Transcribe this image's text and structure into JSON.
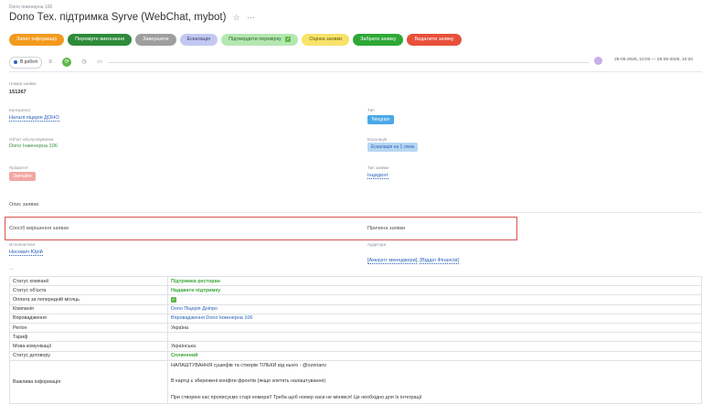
{
  "breadcrumb": "Dono Інженерна 106",
  "title": "Dono Тех. підтримка Syrve (WebChat, mybot)",
  "actions": [
    {
      "label": "Запит інформації",
      "color": "#f39a1e"
    },
    {
      "label": "Перевірте виконання",
      "color": "#2e8b3a"
    },
    {
      "label": "Завершити",
      "color": "#9e9e9e"
    },
    {
      "label": "Ескалація",
      "color": "#c3c8f2"
    },
    {
      "label": "Підтвердити перевірку",
      "color": "#b5e7b1"
    },
    {
      "label": "Оцінка заявки",
      "color": "#f7e36a"
    },
    {
      "label": "Забрати заявку",
      "color": "#2ea836"
    },
    {
      "label": "Видалити заявку",
      "color": "#e8503a"
    }
  ],
  "status": {
    "label": "В роботі",
    "date_range": "28-05-2026, 10:03 — 28-05-2026, 10:20"
  },
  "fields": {
    "number_label": "Номер заявки",
    "number_value": "151267",
    "contractor_label": "Контрагент",
    "contractor_value": "Наталі піцерія ДОНО",
    "type_label": "Тип",
    "type_value": "Telegram",
    "object_label": "Об'єкт обслуговування",
    "object_value": "Dono Інженерна 106",
    "escalation_label": "Ескалація",
    "escalation_value": "Ескалація на 1 лінію",
    "priority_label": "Пріоритет",
    "priority_value": "Звичайні",
    "request_type_label": "Тип заявки",
    "request_type_value": "Інцидент",
    "description_label": "Опис заявки",
    "solution_label": "Спосіб вирішення заявки",
    "cause_label": "Причина заявки",
    "executor_label": "Исполнители",
    "executor_value": "Носевич Юрій",
    "auditors_label": "Аудитори",
    "auditor_1": "[Аккаунт менеджери]",
    "auditor_2": "[Відділ Фінансів]",
    "ellipsis": "..."
  },
  "props": [
    {
      "key": "Статус компанії",
      "value": "Підтримка ресторан",
      "style": "g"
    },
    {
      "key": "Статус об'єкта",
      "value": "Надавати підтримку",
      "style": "g"
    },
    {
      "key": "Оплата за попередній місяць",
      "value": "",
      "style": "chk"
    },
    {
      "key": "Компанія",
      "value": "Dono Піцерія Дніпро",
      "style": "b"
    },
    {
      "key": "Впровадження",
      "value": "Впровадження Dono Інженерна 106",
      "style": "b"
    },
    {
      "key": "Регіон",
      "value": "Україна",
      "style": ""
    },
    {
      "key": "Тариф",
      "value": "",
      "style": ""
    },
    {
      "key": "Мова комунікації",
      "value": "Українська",
      "style": ""
    },
    {
      "key": "Статус договору",
      "value": "Сплачений",
      "style": "g"
    }
  ],
  "important": {
    "key": "Важлива інформація",
    "lines": [
      "НАЛАШТУВАННЯ сушефів та стікерів ТІЛЬКИ від нього - @ozerianv",
      "В картці є збережені конфіги фронтів (якщо злетять налаштування)",
      "При створені кас прописуємо старі номера!! Треба щоб номер каси не мінявся! Це необхідно для їх інтеграції"
    ]
  }
}
